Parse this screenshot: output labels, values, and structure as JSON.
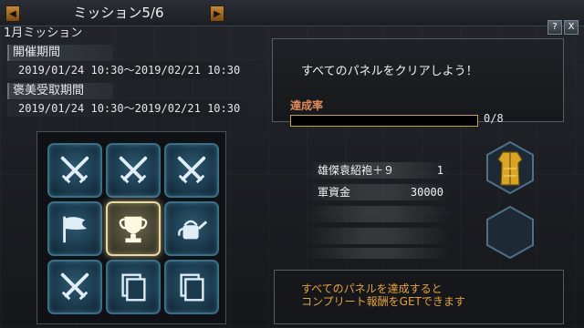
{
  "header": {
    "title": "ミッション5/6",
    "subtitle": "1月ミッション"
  },
  "period": {
    "held_label": "開催期間",
    "held_dates": "2019/01/24 10:30～2019/02/21 10:30",
    "reward_label": "褒美受取期間",
    "reward_dates": "2019/01/24 10:30～2019/02/21 10:30"
  },
  "panel_grid": [
    {
      "icon": "crossed-swords-icon",
      "active": false
    },
    {
      "icon": "crossed-swords-icon",
      "active": false
    },
    {
      "icon": "crossed-swords-icon",
      "active": false
    },
    {
      "icon": "flag-icon",
      "active": false
    },
    {
      "icon": "trophy-icon",
      "active": true
    },
    {
      "icon": "watering-can-icon",
      "active": false
    },
    {
      "icon": "crossed-swords-icon",
      "active": false
    },
    {
      "icon": "cards-icon",
      "active": false
    },
    {
      "icon": "cards-icon",
      "active": false
    }
  ],
  "mission": {
    "description": "すべてのパネルをクリアしよう！",
    "rate_label": "達成率",
    "progress_text": "0/8",
    "progress_fraction": 0
  },
  "rewards": [
    {
      "name": "雄傑袁紹袍＋９",
      "qty": "1"
    },
    {
      "name": "軍資金",
      "qty": "30000"
    }
  ],
  "footer": {
    "line1": "すべてのパネルを達成すると",
    "line2": "コンプリート報酬をGETできます"
  },
  "window_buttons": {
    "help": "?",
    "close": "X"
  },
  "colors": {
    "accent": "#e6a23e",
    "rate": "#e08a5a",
    "cell_border": "#3a6f88",
    "active_border": "#e8d9a0"
  }
}
